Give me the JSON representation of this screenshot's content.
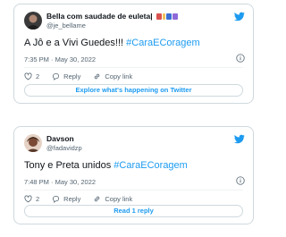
{
  "tweets": [
    {
      "display_name": "Bella com saudade de euleta|",
      "handle": "@je_bellame",
      "text": "A Jô e a Vivi Guedes!!! ",
      "hashtag": "#CaraECoragem",
      "timestamp": "7:35 PM · May 30, 2022",
      "like_count": "2",
      "reply_label": "Reply",
      "copy_link_label": "Copy link",
      "cta_label": "Explore what's happening on Twitter"
    },
    {
      "display_name": "Davson",
      "handle": "@fadavidzp",
      "text": "Tony e Preta unidos ",
      "hashtag": "#CaraECoragem",
      "timestamp": "7:48 PM · May 30, 2022",
      "like_count": "2",
      "reply_label": "Reply",
      "copy_link_label": "Copy link",
      "cta_label": "Read 1 reply"
    }
  ],
  "colors": {
    "accent": "#1d9bf0",
    "text": "#0f1419",
    "muted": "#536471",
    "border": "#cfd9de"
  },
  "icons": [
    "twitter-bird-icon",
    "info-icon",
    "heart-icon",
    "reply-icon",
    "link-icon"
  ]
}
